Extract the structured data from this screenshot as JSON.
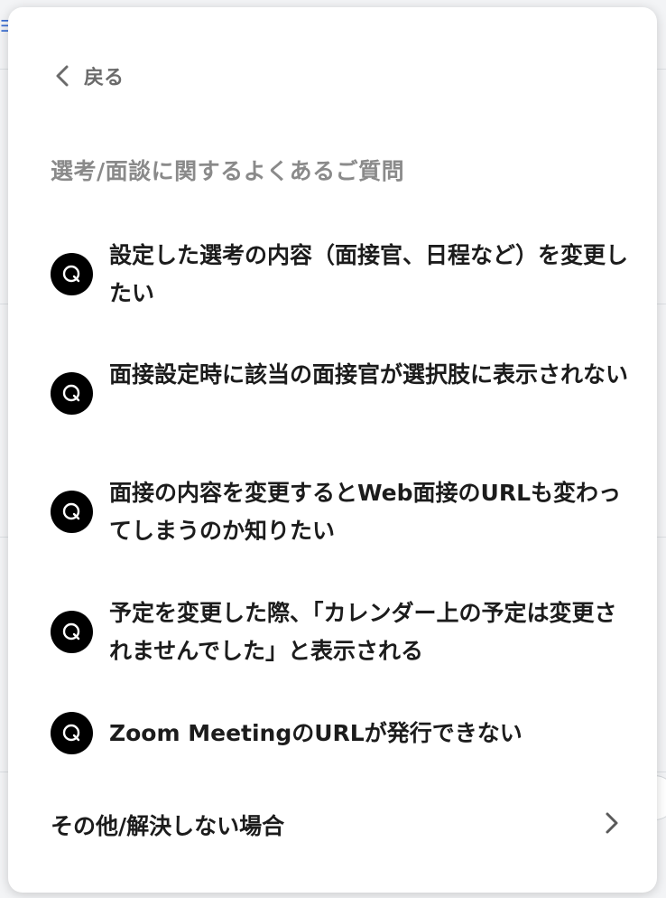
{
  "panel": {
    "back_label": "戻る",
    "section_title": "選考/面談に関するよくあるご質問",
    "faq_items": [
      {
        "badge": "Q",
        "text": "設定した選考の内容（面接官、日程など）を変更したい"
      },
      {
        "badge": "Q",
        "text": "面接設定時に該当の面接官が選択肢に表示されない"
      },
      {
        "badge": "Q",
        "text": "面接の内容を変更するとWeb面接のURLも変わってしまうのか知りたい"
      },
      {
        "badge": "Q",
        "text": "予定を変更した際、「カレンダー上の予定は変更されませんでした」と表示される"
      },
      {
        "badge": "Q",
        "text": "Zoom MeetingのURLが発行できない"
      }
    ],
    "other_label": "その他/解決しない場合"
  },
  "icons": {
    "back": "chevron-left-icon",
    "other": "chevron-right-icon",
    "question": "q-icon"
  },
  "colors": {
    "badge_bg": "#000000",
    "text": "#1c1c1c",
    "muted": "#8a8a8a"
  }
}
